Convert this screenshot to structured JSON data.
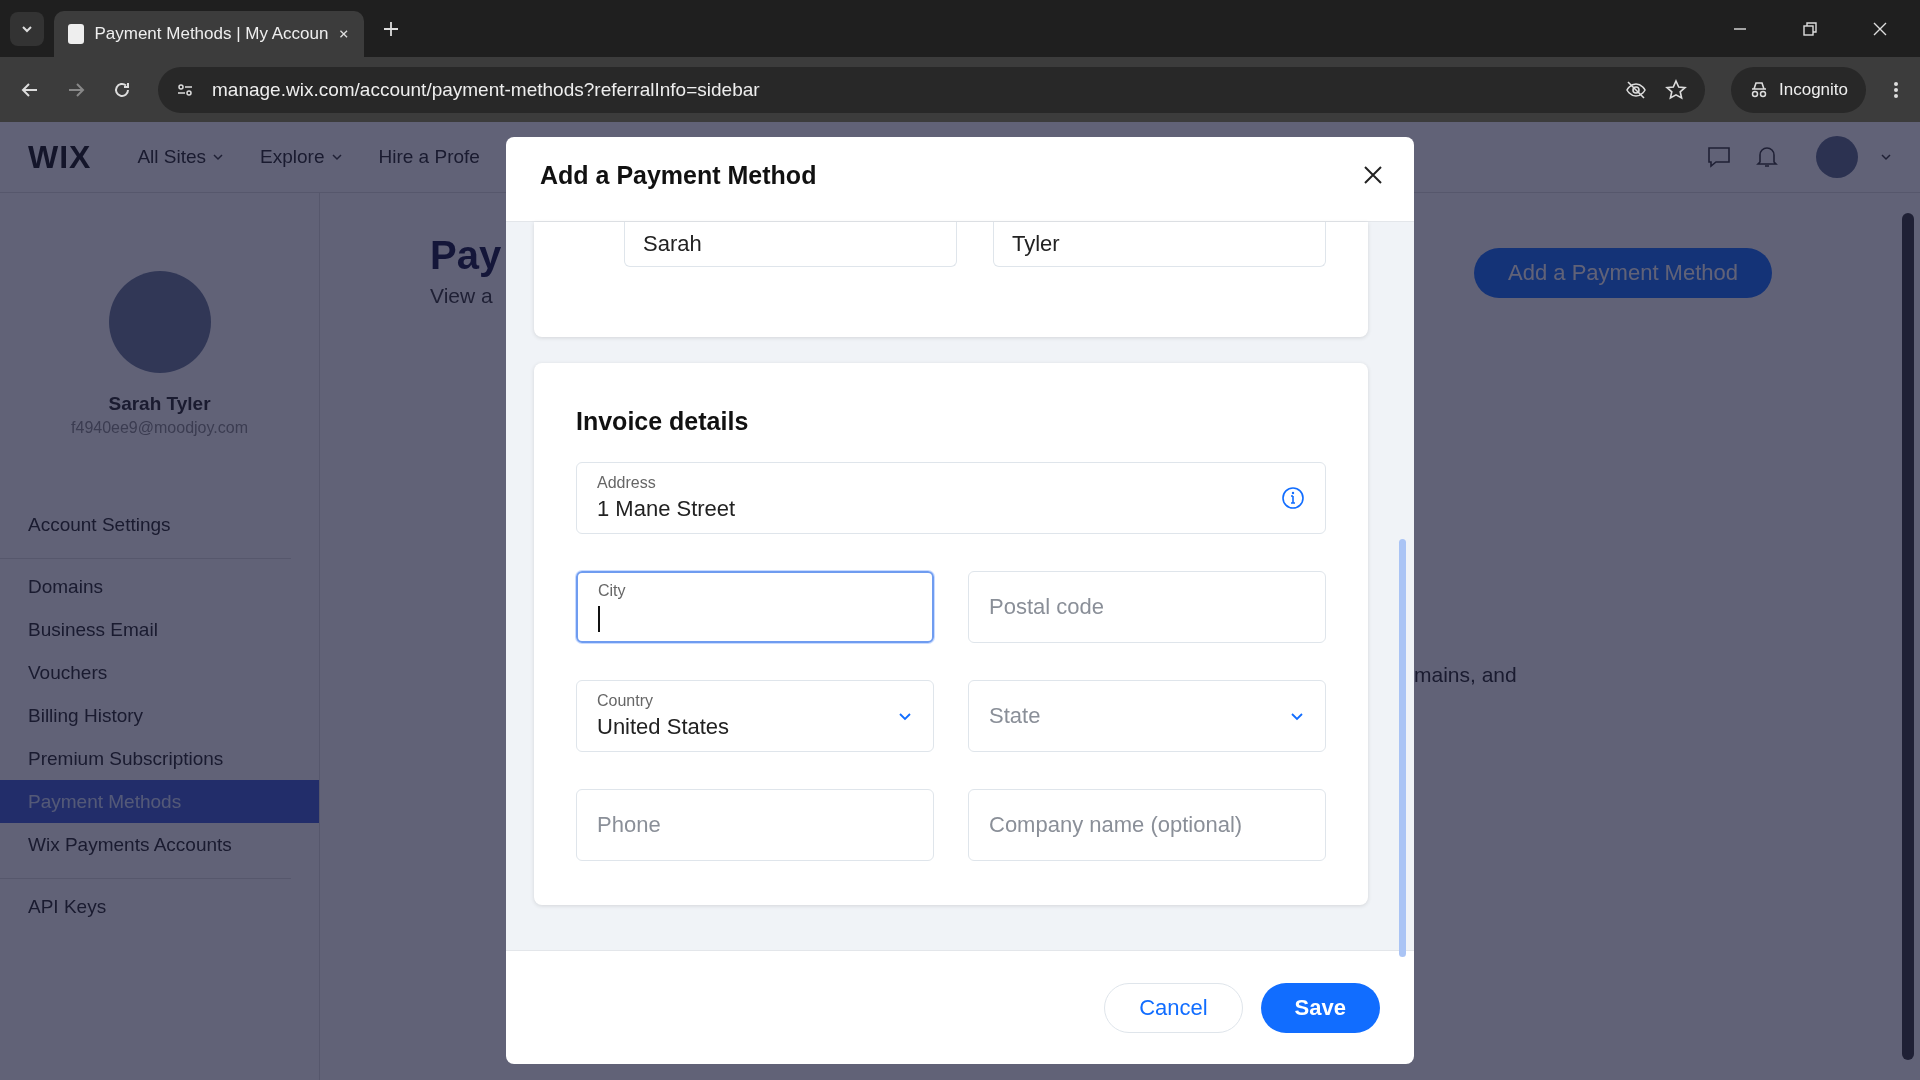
{
  "browser": {
    "tab_title": "Payment Methods | My Accoun",
    "url": "manage.wix.com/account/payment-methods?referralInfo=sidebar",
    "incognito_label": "Incognito"
  },
  "header": {
    "logo": "WIX",
    "nav": [
      {
        "label": "All Sites",
        "dropdown": true
      },
      {
        "label": "Explore",
        "dropdown": true
      },
      {
        "label": "Hire a Profe",
        "dropdown": false
      }
    ]
  },
  "sidebar": {
    "user_name": "Sarah Tyler",
    "email": "f4940ee9@moodjoy.com",
    "groups": [
      [
        {
          "label": "Account Settings",
          "selected": false
        }
      ],
      [
        {
          "label": "Domains",
          "selected": false
        },
        {
          "label": "Business Email",
          "selected": false
        },
        {
          "label": "Vouchers",
          "selected": false
        },
        {
          "label": "Billing History",
          "selected": false
        },
        {
          "label": "Premium Subscriptions",
          "selected": false
        },
        {
          "label": "Payment Methods",
          "selected": true
        },
        {
          "label": "Wix Payments Accounts",
          "selected": false
        }
      ],
      [
        {
          "label": "API Keys",
          "selected": false
        }
      ]
    ]
  },
  "page": {
    "title": "Pay",
    "subtitle": "View a",
    "add_button": "Add a Payment Method",
    "body_text": "mains, and"
  },
  "modal": {
    "title": "Add a Payment Method",
    "name_fields": [
      {
        "value": "Sarah"
      },
      {
        "value": "Tyler"
      }
    ],
    "section_title": "Invoice details",
    "fields": [
      {
        "kind": "text",
        "label": "Address",
        "value": "1 Mane Street",
        "info": true,
        "focused": false,
        "wide": true
      },
      {
        "kind": "text",
        "label": "City",
        "focused": true,
        "info": false,
        "wide": false
      },
      {
        "kind": "text",
        "placeholder": "Postal code",
        "focused": false,
        "info": false,
        "wide": false
      },
      {
        "kind": "select",
        "label": "Country",
        "value": "United States",
        "focused": false,
        "info": false,
        "wide": false
      },
      {
        "kind": "select",
        "placeholder": "State",
        "focused": false,
        "info": false,
        "wide": false
      },
      {
        "kind": "text",
        "placeholder": "Phone",
        "focused": false,
        "info": false,
        "wide": false
      },
      {
        "kind": "text",
        "placeholder": "Company name (optional)",
        "focused": false,
        "info": false,
        "wide": false
      }
    ],
    "cancel": "Cancel",
    "save": "Save"
  }
}
